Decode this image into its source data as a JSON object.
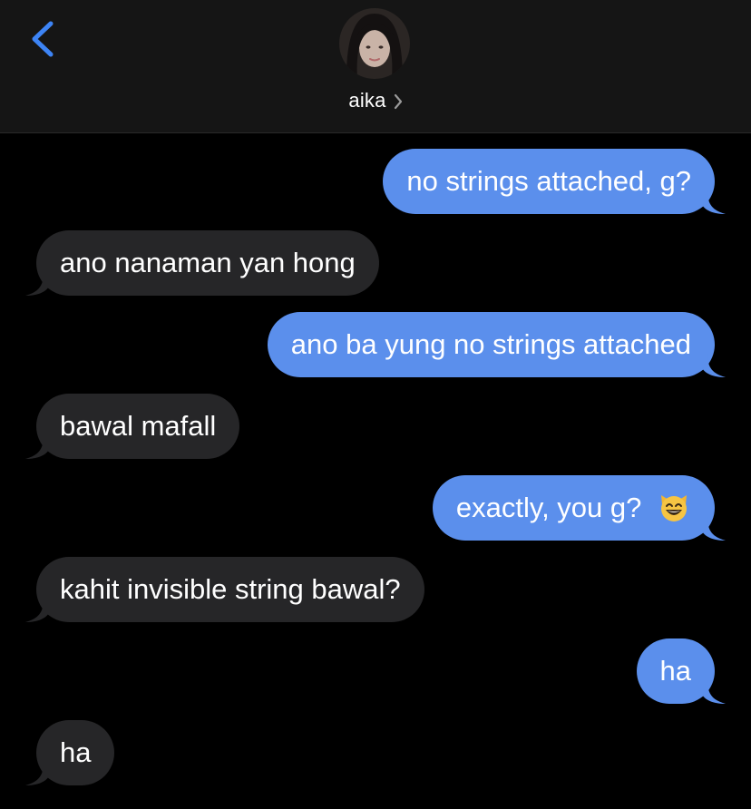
{
  "header": {
    "back_icon": "chevron-left-icon",
    "contact_name": "aika",
    "chevron_icon": "chevron-right-icon",
    "avatar_icon": "contact-avatar"
  },
  "messages": [
    {
      "side": "sent",
      "text": "no strings attached, g?"
    },
    {
      "side": "received",
      "text": "ano nanaman yan hong"
    },
    {
      "side": "sent",
      "text": "ano ba yung no strings attached"
    },
    {
      "side": "received",
      "text": "bawal mafall"
    },
    {
      "side": "sent",
      "text": "exactly, you g?",
      "emoji": "grinning-cat-emoji"
    },
    {
      "side": "received",
      "text": "kahit invisible string bawal?"
    },
    {
      "side": "sent",
      "text": "ha"
    },
    {
      "side": "received",
      "text": "ha"
    }
  ],
  "colors": {
    "sent_bubble": "#5b8fec",
    "received_bubble": "#262628",
    "background": "#000000",
    "header_background": "#151515",
    "accent": "#3d84f5"
  }
}
